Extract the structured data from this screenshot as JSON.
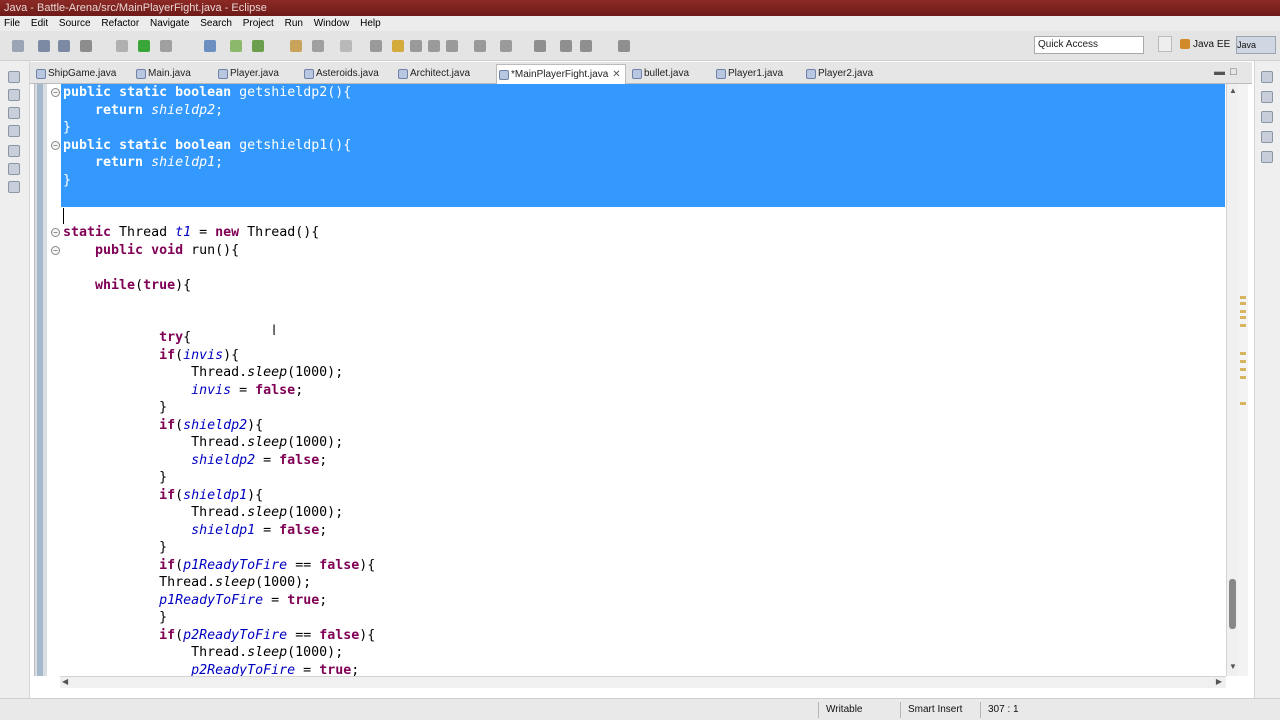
{
  "window": {
    "title": "Java - Battle-Arena/src/MainPlayerFight.java - Eclipse"
  },
  "menu": [
    "File",
    "Edit",
    "Source",
    "Refactor",
    "Navigate",
    "Search",
    "Project",
    "Run",
    "Window",
    "Help"
  ],
  "toolbar": {
    "quick_access_placeholder": "Quick Access",
    "perspective_javaee": "Java EE",
    "perspective_java": "Java"
  },
  "tabs": [
    {
      "label": "ShipGame.java"
    },
    {
      "label": "Main.java"
    },
    {
      "label": "Player.java"
    },
    {
      "label": "Asteroids.java"
    },
    {
      "label": "Architect.java"
    },
    {
      "label": "*MainPlayerFight.java",
      "active": true
    },
    {
      "label": "bullet.java"
    },
    {
      "label": "Player1.java"
    },
    {
      "label": "Player2.java"
    }
  ],
  "editor": {
    "lines": [
      "public static boolean getshieldp2(){",
      "    return shieldp2;",
      "}",
      "public static boolean getshieldp1(){",
      "    return shieldp1;",
      "}",
      "",
      "static Thread t1 = new Thread(){",
      "    public void run(){",
      "",
      "    while(true){",
      "",
      "",
      "            try{",
      "            if(invis){",
      "                Thread.sleep(1000);",
      "                invis = false;",
      "            }",
      "            if(shieldp2){",
      "                Thread.sleep(1000);",
      "                shieldp2 = false;",
      "            }",
      "            if(shieldp1){",
      "                Thread.sleep(1000);",
      "                shieldp1 = false;",
      "            }",
      "            if(p1ReadyToFire == false){",
      "            Thread.sleep(1000);",
      "            p1ReadyToFire = true;",
      "            }",
      "            if(p2ReadyToFire == false){",
      "                Thread.sleep(1000);",
      "                p2ReadyToFire = true;"
    ]
  },
  "status": {
    "mode": "Writable",
    "insert": "Smart Insert",
    "position": "307 : 1"
  },
  "colors": {
    "selection": "#3399ff",
    "keyword": "#7f0055",
    "field": "#0000c0",
    "title_bar": "#7a211e"
  }
}
